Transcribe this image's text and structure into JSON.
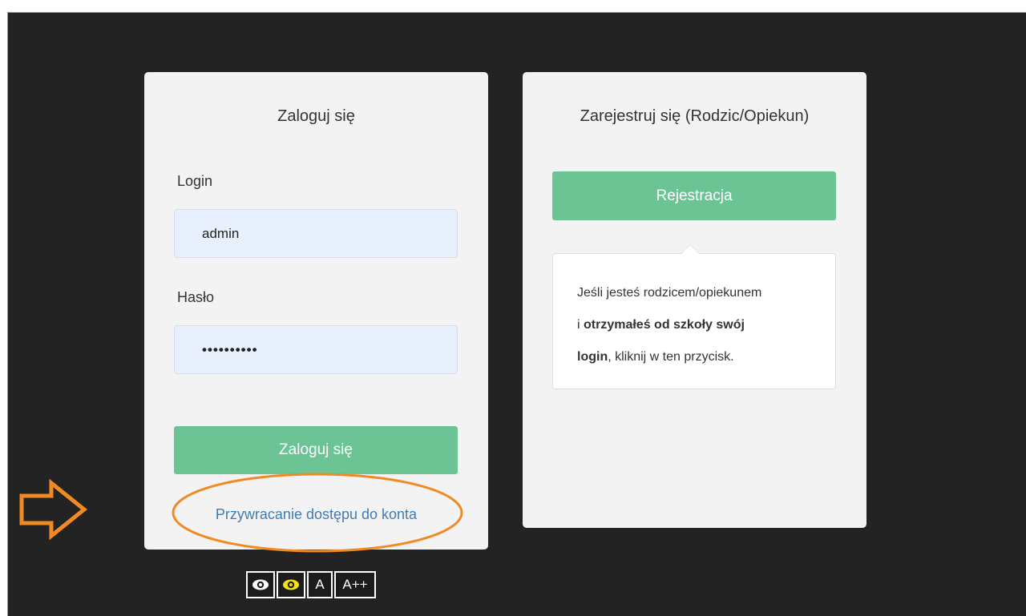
{
  "login_card": {
    "title": "Zaloguj się",
    "login_label": "Login",
    "login_value": "admin",
    "password_label": "Hasło",
    "password_value": "••••••••••",
    "submit_label": "Zaloguj się",
    "recover_link": "Przywracanie dostępu do konta"
  },
  "register_card": {
    "title": "Zarejestruj się (Rodzic/Opiekun)",
    "button_label": "Rejestracja",
    "popover": {
      "text_1": "Jeśli jesteś rodzicem/opiekunem",
      "text_2": "i ",
      "text_3": "otrzymałeś od szkoły swój",
      "text_4": "login",
      "text_5": ", kliknij w ten przycisk."
    }
  },
  "accessibility": {
    "contrast_icon": "eye-icon",
    "yellow_contrast_icon": "eye-yellow-icon",
    "font_normal_label": "A",
    "font_large_label": "A++"
  },
  "colors": {
    "background": "#232323",
    "card": "#f3f3f3",
    "accent_green": "#6cc494",
    "link_blue": "#3f7cb3",
    "annotation_orange": "#f08a24",
    "input_bg": "#e8f0fe"
  }
}
